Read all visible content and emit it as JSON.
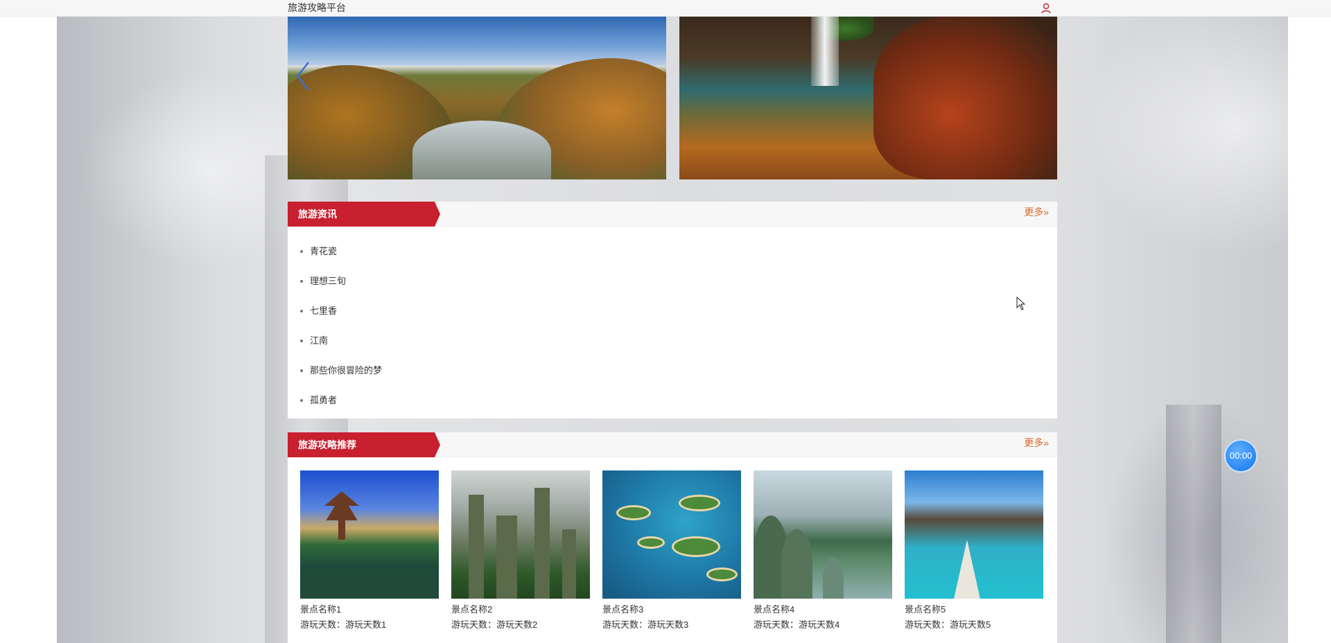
{
  "header": {
    "site_title": "旅游攻略平台",
    "user_icon": "user-icon"
  },
  "carousel": {
    "prev_icon": "chevron-left-icon",
    "slides": [
      "autumn-valley-river",
      "waterfall-red-rocks"
    ]
  },
  "news": {
    "title": "旅游资讯",
    "more": "更多",
    "items": [
      "青花瓷",
      "理想三旬",
      "七里香",
      "江南",
      "那些你很冒险的梦",
      "孤勇者"
    ]
  },
  "guides": {
    "title": "旅游攻略推荐",
    "more": "更多",
    "cards": [
      {
        "name": "景点名称1",
        "days": "游玩天数：游玩天数1"
      },
      {
        "name": "景点名称2",
        "days": "游玩天数：游玩天数2"
      },
      {
        "name": "景点名称3",
        "days": "游玩天数：游玩天数3"
      },
      {
        "name": "景点名称4",
        "days": "游玩天数：游玩天数4"
      },
      {
        "name": "景点名称5",
        "days": "游玩天数：游玩天数5"
      }
    ]
  },
  "timer": "00:00",
  "colors": {
    "accent_red": "#c8202f",
    "more_orange": "#d9662b",
    "timer_blue": "#2a86f0"
  }
}
